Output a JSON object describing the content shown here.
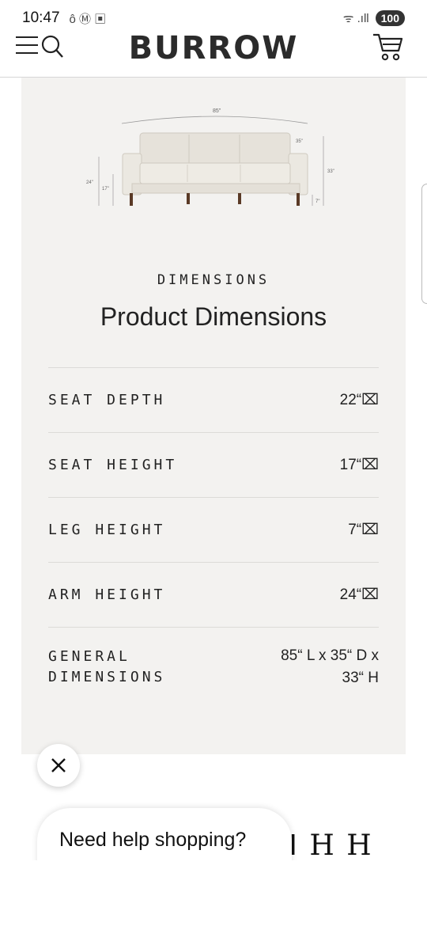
{
  "status_bar": {
    "time": "10:47",
    "notif_icons": "ô Ⓜ ▣",
    "signal": "ᯤ .ıll",
    "battery": "100"
  },
  "header": {
    "logo": "BURROW"
  },
  "product": {
    "image": {
      "width_label": "85\"",
      "depth_label": "35\"",
      "height_label": "33\"",
      "arm_label": "24\"",
      "seat_label": "17\"",
      "leg_label": "7\""
    },
    "eyebrow": "DIMENSIONS",
    "title": "Product Dimensions",
    "dimensions": [
      {
        "label": "SEAT DEPTH",
        "value": "22“⌧"
      },
      {
        "label": "SEAT HEIGHT",
        "value": "17“⌧"
      },
      {
        "label": "LEG HEIGHT",
        "value": "7“⌧"
      },
      {
        "label": "ARM HEIGHT",
        "value": "24“⌧"
      },
      {
        "label": "GENERAL DIMENSIONS",
        "value": "85“ L x 35“ D x 33“ H"
      }
    ]
  },
  "chat": {
    "close_label": "✕",
    "help_text": "Need help shopping?"
  },
  "peek": {
    "text": "ᒧ H H"
  }
}
